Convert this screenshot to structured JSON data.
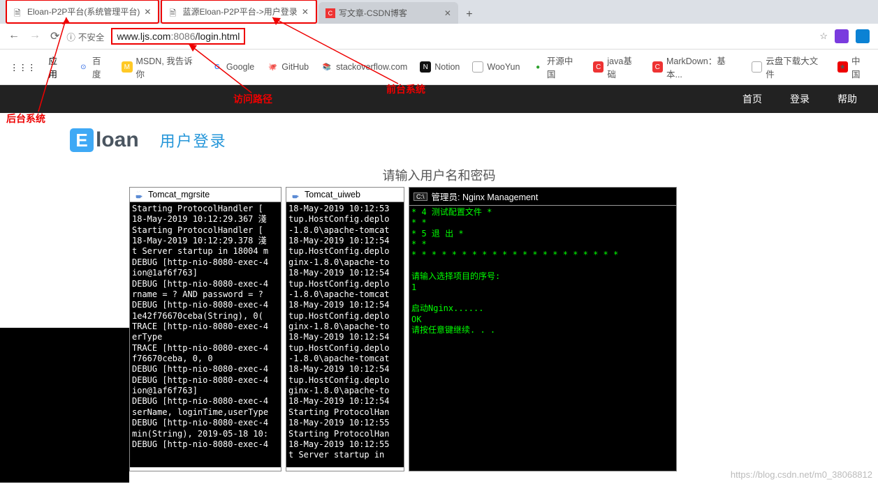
{
  "tabs": [
    {
      "title": "Eloan-P2P平台(系统管理平台)"
    },
    {
      "title": "蓝源Eloan-P2P平台->用户登录"
    },
    {
      "title": "写文章-CSDN博客"
    }
  ],
  "addressbar": {
    "insecure": "不安全",
    "url_host": "www.ljs.com",
    "url_port": ":8086",
    "url_path": "/login.html"
  },
  "bookmarks": {
    "label": "应用",
    "items": [
      "百度",
      "MSDN, 我告诉你",
      "Google",
      "GitHub",
      "stackoverflow.com",
      "Notion",
      "WooYun",
      "开源中国",
      "java基础",
      "MarkDown：基本...",
      "云盘下载大文件",
      "中国"
    ]
  },
  "header": {
    "home": "首页",
    "login": "登录",
    "help": "帮助"
  },
  "brand": {
    "logo": "loan",
    "title": "用户登录",
    "prompt": "请输入用户名和密码"
  },
  "annotations": {
    "back": "后台系统",
    "path": "访问路径",
    "front": "前台系统"
  },
  "term1": {
    "title": "Tomcat_mgrsite",
    "body": "Starting ProtocolHandler [\n18-May-2019 10:12:29.367 淺\nStarting ProtocolHandler [\n18-May-2019 10:12:29.378 淺\nt Server startup in 18004 m\nDEBUG [http-nio-8080-exec-4\nion@1af6f763]\nDEBUG [http-nio-8080-exec-4\nrname = ? AND password = ?\nDEBUG [http-nio-8080-exec-4\n1e42f76670ceba(String), 0(\nTRACE [http-nio-8080-exec-4\nerType\nTRACE [http-nio-8080-exec-4\nf76670ceba, 0, 0\nDEBUG [http-nio-8080-exec-4\nDEBUG [http-nio-8080-exec-4\nion@1af6f763]\nDEBUG [http-nio-8080-exec-4\nserName, loginTime,userType\nDEBUG [http-nio-8080-exec-4\nmin(String), 2019-05-18 10:\nDEBUG [http-nio-8080-exec-4"
  },
  "term2": {
    "title": "Tomcat_uiweb",
    "body": "18-May-2019 10:12:53\ntup.HostConfig.deplo\n-1.8.0\\apache-tomcat\n18-May-2019 10:12:54\ntup.HostConfig.deplo\nginx-1.8.0\\apache-to\n18-May-2019 10:12:54\ntup.HostConfig.deplo\n-1.8.0\\apache-tomcat\n18-May-2019 10:12:54\ntup.HostConfig.deplo\nginx-1.8.0\\apache-to\n18-May-2019 10:12:54\ntup.HostConfig.deplo\n-1.8.0\\apache-tomcat\n18-May-2019 10:12:54\ntup.HostConfig.deplo\nginx-1.8.0\\apache-to\n18-May-2019 10:12:54\nStarting ProtocolHan\n18-May-2019 10:12:55\nStarting ProtocolHan\n18-May-2019 10:12:55\nt Server startup in "
  },
  "term3": {
    "title": "管理员: Nginx Management",
    "body": "* 4 测试配置文件 *\n* *\n* 5 退 出 *\n* *\n* * * * * * * * * * * * * * * * * * * * *\n\n请输入选择项目的序号:\n1\n\n启动Nginx......\nOK\n请按任意键继续. . ."
  },
  "watermark": "https://blog.csdn.net/m0_38068812"
}
